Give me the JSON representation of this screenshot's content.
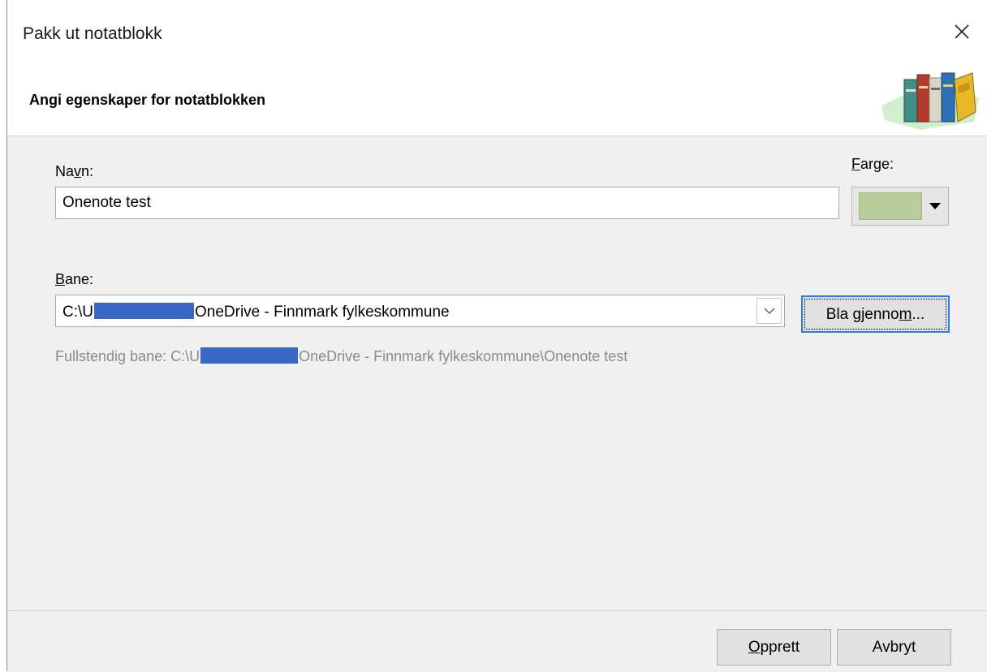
{
  "window": {
    "title": "Pakk ut notatblokk"
  },
  "header": {
    "subtitle": "Angi egenskaper for notatblokken"
  },
  "form": {
    "name_label_pre": "Na",
    "name_label_mnemonic": "v",
    "name_label_post": "n:",
    "name_value": "Onenote test",
    "color_label_mnemonic": "F",
    "color_label_post": "arge:",
    "color_value": "#b9cd98",
    "path_label_mnemonic": "B",
    "path_label_post": "ane:",
    "path_value_prefix": "C:\\U",
    "path_value_suffix": "OneDrive - Finnmark fylkeskommune",
    "browse_pre": "Bla gjenno",
    "browse_mnemonic": "m",
    "browse_post": "...",
    "fullpath_prefix": "Fullstendig bane: C:\\U",
    "fullpath_suffix": "OneDrive - Finnmark fylkeskommune\\Onenote test"
  },
  "footer": {
    "create_mnemonic": "O",
    "create_post": "pprett",
    "cancel_label": "Avbryt"
  }
}
